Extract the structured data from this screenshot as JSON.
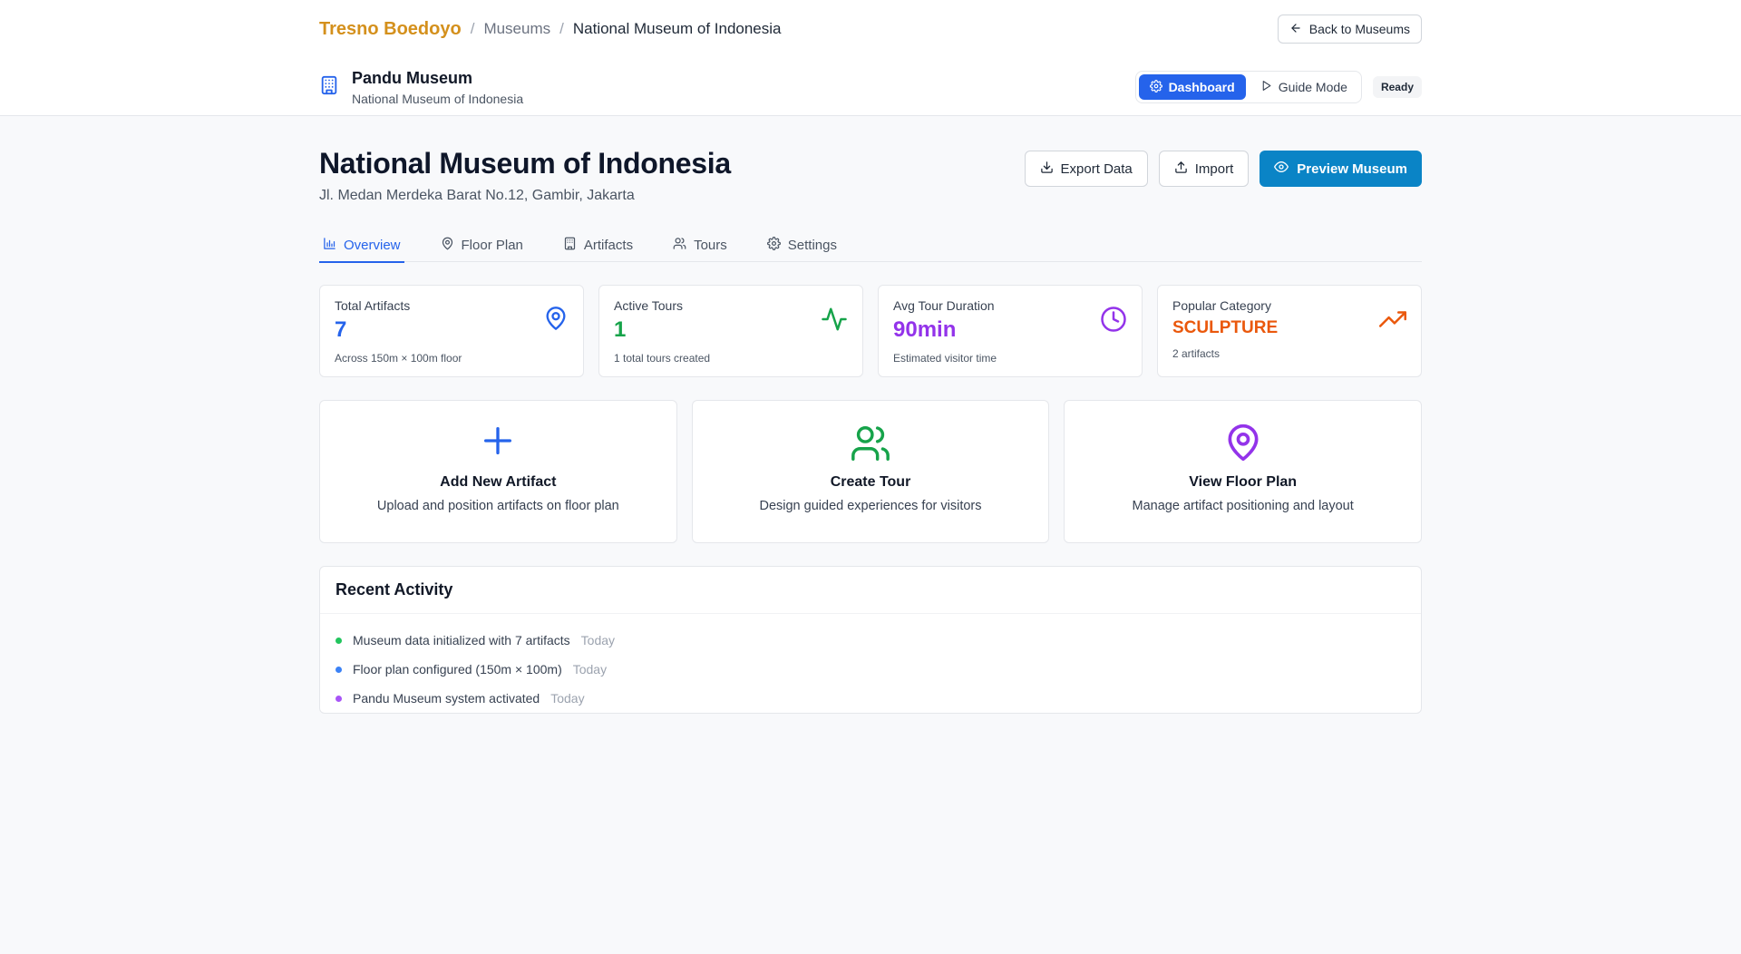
{
  "breadcrumb": {
    "brand": "Tresno Boedoyo",
    "separator": "/",
    "museums": "Museums",
    "current": "National Museum of Indonesia"
  },
  "back_button": "Back to Museums",
  "app": {
    "title": "Pandu Museum",
    "subtitle": "National Museum of Indonesia",
    "modes": {
      "dashboard": "Dashboard",
      "guide": "Guide Mode"
    },
    "status": "Ready"
  },
  "page": {
    "title": "National Museum of Indonesia",
    "address": "Jl. Medan Merdeka Barat No.12, Gambir, Jakarta",
    "actions": {
      "export": "Export Data",
      "import": "Import",
      "preview": "Preview Museum"
    }
  },
  "tabs": [
    {
      "label": "Overview",
      "icon": "bar-chart-icon",
      "active": true
    },
    {
      "label": "Floor Plan",
      "icon": "map-pin-icon",
      "active": false
    },
    {
      "label": "Artifacts",
      "icon": "building-icon",
      "active": false
    },
    {
      "label": "Tours",
      "icon": "users-icon",
      "active": false
    },
    {
      "label": "Settings",
      "icon": "gear-icon",
      "active": false
    }
  ],
  "stats": [
    {
      "label": "Total Artifacts",
      "value": "7",
      "note": "Across 150m × 100m floor",
      "color": "#2563eb",
      "icon": "map-pin-icon"
    },
    {
      "label": "Active Tours",
      "value": "1",
      "note": "1 total tours created",
      "color": "#16a34a",
      "icon": "activity-icon"
    },
    {
      "label": "Avg Tour Duration",
      "value": "90min",
      "note": "Estimated visitor time",
      "color": "#9333ea",
      "icon": "clock-icon"
    },
    {
      "label": "Popular Category",
      "value": "SCULPTURE",
      "note": "2 artifacts",
      "color": "#ea580c",
      "icon": "trending-up-icon"
    }
  ],
  "quick_actions": [
    {
      "title": "Add New Artifact",
      "desc": "Upload and position artifacts on floor plan",
      "color": "#2563eb",
      "icon": "plus-icon"
    },
    {
      "title": "Create Tour",
      "desc": "Design guided experiences for visitors",
      "color": "#16a34a",
      "icon": "users-icon"
    },
    {
      "title": "View Floor Plan",
      "desc": "Manage artifact positioning and layout",
      "color": "#9333ea",
      "icon": "map-pin-icon"
    }
  ],
  "activity": {
    "title": "Recent Activity",
    "items": [
      {
        "text": "Museum data initialized with 7 artifacts",
        "time": "Today",
        "color": "#22c55e"
      },
      {
        "text": "Floor plan configured (150m × 100m)",
        "time": "Today",
        "color": "#3b82f6"
      },
      {
        "text": "Pandu Museum system activated",
        "time": "Today",
        "color": "#a855f7"
      }
    ]
  }
}
